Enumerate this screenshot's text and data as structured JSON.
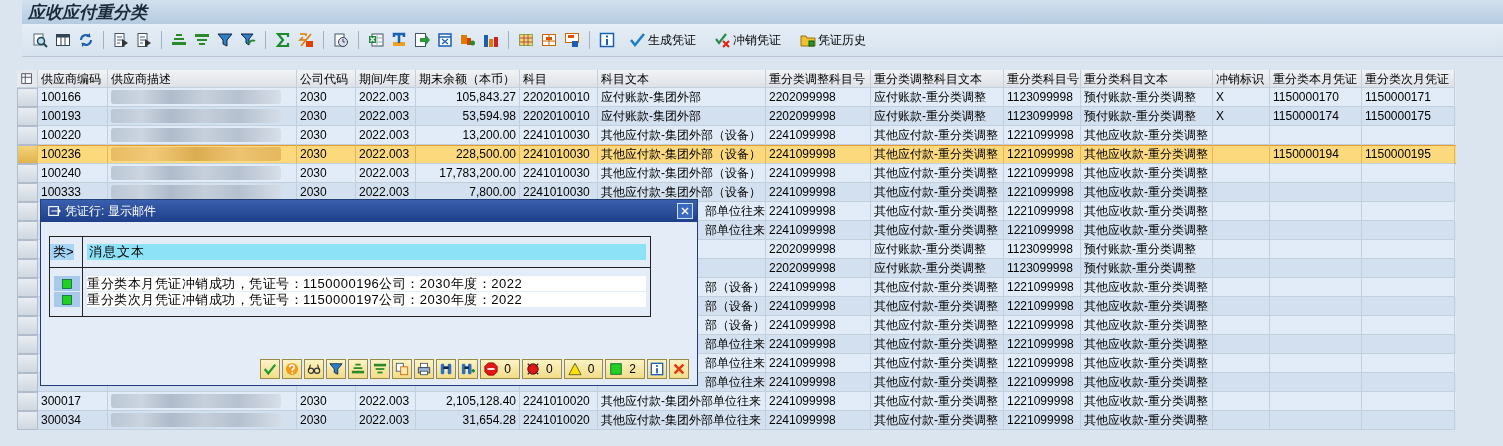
{
  "window": {
    "title": "应收应付重分类"
  },
  "toolbar": {
    "buttons": [
      {
        "kind": "create",
        "label": "生成凭证"
      },
      {
        "kind": "reverse",
        "label": "冲销凭证"
      },
      {
        "kind": "history",
        "label": "凭证历史"
      }
    ]
  },
  "table": {
    "columns": [
      "供应商编码",
      "供应商描述",
      "公司代码",
      "期间/年度",
      "期末余额（本币）",
      "科目",
      "科目文本",
      "重分类调整科目号",
      "重分类调整科目文本",
      "重分类科目号",
      "重分类科目文本",
      "冲销标识",
      "重分类本月凭证",
      "重分类次月凭证"
    ],
    "rows": [
      {
        "selected": false,
        "vendor_code": "100166",
        "company_code": "2030",
        "period": "2022.003",
        "balance": "105,843.27",
        "account": "2202010010",
        "account_text": "应付账款-集团外部",
        "adj_account": "2202099998",
        "adj_account_text": "应付账款-重分类调整",
        "reclass_account": "1123099998",
        "reclass_account_text": "预付账款-重分类调整",
        "reversal_flag": "X",
        "voucher_this_month": "1150000170",
        "voucher_next_month": "1150000171"
      },
      {
        "selected": false,
        "vendor_code": "100193",
        "company_code": "2030",
        "period": "2022.003",
        "balance": "53,594.98",
        "account": "2202010010",
        "account_text": "应付账款-集团外部",
        "adj_account": "2202099998",
        "adj_account_text": "应付账款-重分类调整",
        "reclass_account": "1123099998",
        "reclass_account_text": "预付账款-重分类调整",
        "reversal_flag": "X",
        "voucher_this_month": "1150000174",
        "voucher_next_month": "1150000175"
      },
      {
        "selected": false,
        "vendor_code": "100220",
        "company_code": "2030",
        "period": "2022.003",
        "balance": "13,200.00",
        "account": "2241010030",
        "account_text": "其他应付款-集团外部（设备）",
        "adj_account": "2241099998",
        "adj_account_text": "其他应付款-重分类调整",
        "reclass_account": "1221099998",
        "reclass_account_text": "其他应收款-重分类调整"
      },
      {
        "selected": true,
        "vendor_code": "100236",
        "company_code": "2030",
        "period": "2022.003",
        "balance": "228,500.00",
        "account": "2241010030",
        "account_text": "其他应付款-集团外部（设备）",
        "adj_account": "2241099998",
        "adj_account_text": "其他应付款-重分类调整",
        "reclass_account": "1221099998",
        "reclass_account_text": "其他应收款-重分类调整",
        "voucher_this_month": "1150000194",
        "voucher_next_month": "1150000195"
      },
      {
        "selected": false,
        "vendor_code": "100240",
        "company_code": "2030",
        "period": "2022.003",
        "balance": "17,783,200.00",
        "account": "2241010030",
        "account_text": "其他应付款-集团外部（设备）",
        "adj_account": "2241099998",
        "adj_account_text": "其他应付款-重分类调整",
        "reclass_account": "1221099998",
        "reclass_account_text": "其他应收款-重分类调整"
      },
      {
        "selected": false,
        "vendor_code": "100333",
        "company_code": "2030",
        "period": "2022.003",
        "balance": "7,800.00",
        "account": "2241010030",
        "account_text": "其他应付款-集团外部（设备）",
        "adj_account": "2241099998",
        "adj_account_text": "其他应付款-重分类调整",
        "reclass_account": "1221099998",
        "reclass_account_text": "其他应收款-重分类调整"
      },
      {
        "selected": false,
        "account_text": "部单位往来",
        "adj_account": "2241099998",
        "adj_account_text": "其他应付款-重分类调整",
        "reclass_account": "1221099998",
        "reclass_account_text": "其他应收款-重分类调整"
      },
      {
        "selected": false,
        "account_text": "部单位往来",
        "adj_account": "2241099998",
        "adj_account_text": "其他应付款-重分类调整",
        "reclass_account": "1221099998",
        "reclass_account_text": "其他应收款-重分类调整"
      },
      {
        "selected": false,
        "adj_account": "2202099998",
        "adj_account_text": "应付账款-重分类调整",
        "reclass_account": "1123099998",
        "reclass_account_text": "预付账款-重分类调整"
      },
      {
        "selected": false,
        "adj_account": "2202099998",
        "adj_account_text": "应付账款-重分类调整",
        "reclass_account": "1123099998",
        "reclass_account_text": "预付账款-重分类调整"
      },
      {
        "selected": false,
        "account_text": "部（设备）",
        "adj_account": "2241099998",
        "adj_account_text": "其他应付款-重分类调整",
        "reclass_account": "1221099998",
        "reclass_account_text": "其他应收款-重分类调整"
      },
      {
        "selected": false,
        "account_text": "部（设备）",
        "adj_account": "2241099998",
        "adj_account_text": "其他应付款-重分类调整",
        "reclass_account": "1221099998",
        "reclass_account_text": "其他应收款-重分类调整"
      },
      {
        "selected": false,
        "account_text": "部（设备）",
        "adj_account": "2241099998",
        "adj_account_text": "其他应付款-重分类调整",
        "reclass_account": "1221099998",
        "reclass_account_text": "其他应收款-重分类调整"
      },
      {
        "selected": false,
        "account_text": "部单位往来",
        "adj_account": "2241099998",
        "adj_account_text": "其他应付款-重分类调整",
        "reclass_account": "1221099998",
        "reclass_account_text": "其他应收款-重分类调整"
      },
      {
        "selected": false,
        "account_text": "部单位往来",
        "adj_account": "2241099998",
        "adj_account_text": "其他应付款-重分类调整",
        "reclass_account": "1221099998",
        "reclass_account_text": "其他应收款-重分类调整"
      },
      {
        "selected": false,
        "account_text": "部单位往来",
        "adj_account": "2241099998",
        "adj_account_text": "其他应付款-重分类调整",
        "reclass_account": "1221099998",
        "reclass_account_text": "其他应收款-重分类调整"
      },
      {
        "selected": false,
        "vendor_code": "300017",
        "company_code": "2030",
        "period": "2022.003",
        "balance": "2,105,128.40",
        "account": "2241010020",
        "account_text": "其他应付款-集团外部单位往来",
        "adj_account": "2241099998",
        "adj_account_text": "其他应付款-重分类调整",
        "reclass_account": "1221099998",
        "reclass_account_text": "其他应收款-重分类调整"
      },
      {
        "selected": false,
        "vendor_code": "300034",
        "company_code": "2030",
        "period": "2022.003",
        "balance": "31,654.28",
        "account": "2241010020",
        "account_text": "其他应付款-集团外部单位往来",
        "adj_account": "2241099998",
        "adj_account_text": "其他应付款-重分类调整",
        "reclass_account": "1221099998",
        "reclass_account_text": "其他应收款-重分类调整"
      }
    ]
  },
  "dialog": {
    "title": "凭证行: 显示邮件",
    "columns": [
      "类>",
      "消息文本"
    ],
    "messages": [
      {
        "kind": "success",
        "text": "重分类本月凭证冲销成功，凭证号：1150000196公司：2030年度：2022"
      },
      {
        "kind": "success",
        "text": "重分类次月凭证冲销成功，凭证号：1150000197公司：2030年度：2022"
      }
    ],
    "counters": [
      {
        "kind": "stop",
        "count": "0"
      },
      {
        "kind": "error",
        "count": "0"
      },
      {
        "kind": "warning",
        "count": "0"
      },
      {
        "kind": "success",
        "count": "2"
      }
    ]
  }
}
